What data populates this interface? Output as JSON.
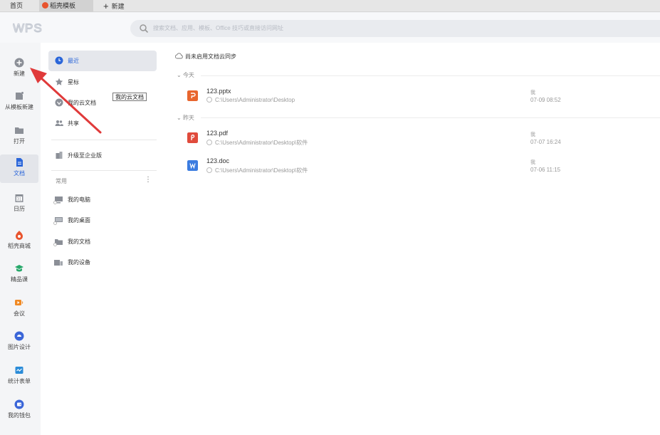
{
  "tabs": {
    "home": "首页",
    "docer": "稻壳模板",
    "new": "新建"
  },
  "header": {
    "logo_text": "WPS",
    "search_placeholder": "搜索文档、应用、模板、Office 技巧或直接访问网址"
  },
  "rail": [
    {
      "label": "新建",
      "icon": "plus-circle-icon"
    },
    {
      "label": "从模板新建",
      "icon": "template-icon"
    },
    {
      "label": "打开",
      "icon": "folder-icon"
    },
    {
      "label": "文档",
      "icon": "document-icon"
    },
    {
      "label": "日历",
      "icon": "calendar-icon"
    },
    {
      "label": "稻壳商城",
      "icon": "docer-store-icon"
    },
    {
      "label": "精品课",
      "icon": "course-icon"
    },
    {
      "label": "会议",
      "icon": "meeting-icon"
    },
    {
      "label": "图片设计",
      "icon": "image-design-icon"
    },
    {
      "label": "统计表单",
      "icon": "form-icon"
    },
    {
      "label": "我的钱包",
      "icon": "wallet-icon"
    }
  ],
  "nav": {
    "recent": "最近",
    "starred": "星标",
    "cloud_docs": "我的云文档",
    "shared": "共享",
    "upgrade": "升级至企业版",
    "common_label": "常用",
    "more": "⋮",
    "places": [
      "我的电脑",
      "我的桌面",
      "我的文档",
      "我的设备"
    ]
  },
  "tooltip": "我的云文档",
  "content": {
    "sync_text": "尚未启用文档云同步",
    "groups": [
      {
        "label": "今天",
        "files": [
          {
            "name": "123.pptx",
            "path": "C:\\Users\\Administrator\\Desktop",
            "owner": "我",
            "time": "07-09 08:52",
            "type": "pptx",
            "color": "#e8662e"
          }
        ]
      },
      {
        "label": "昨天",
        "files": [
          {
            "name": "123.pdf",
            "path": "C:\\Users\\Administrator\\Desktop\\软件",
            "owner": "我",
            "time": "07-07 16:24",
            "type": "pdf",
            "color": "#e04b3c"
          },
          {
            "name": "123.doc",
            "path": "C:\\Users\\Administrator\\Desktop\\软件",
            "owner": "我",
            "time": "07-06 11:15",
            "type": "doc",
            "color": "#3b7ce0"
          }
        ]
      }
    ]
  },
  "colors": {
    "accent": "#2b66d9",
    "arrow": "#e03a3a"
  }
}
